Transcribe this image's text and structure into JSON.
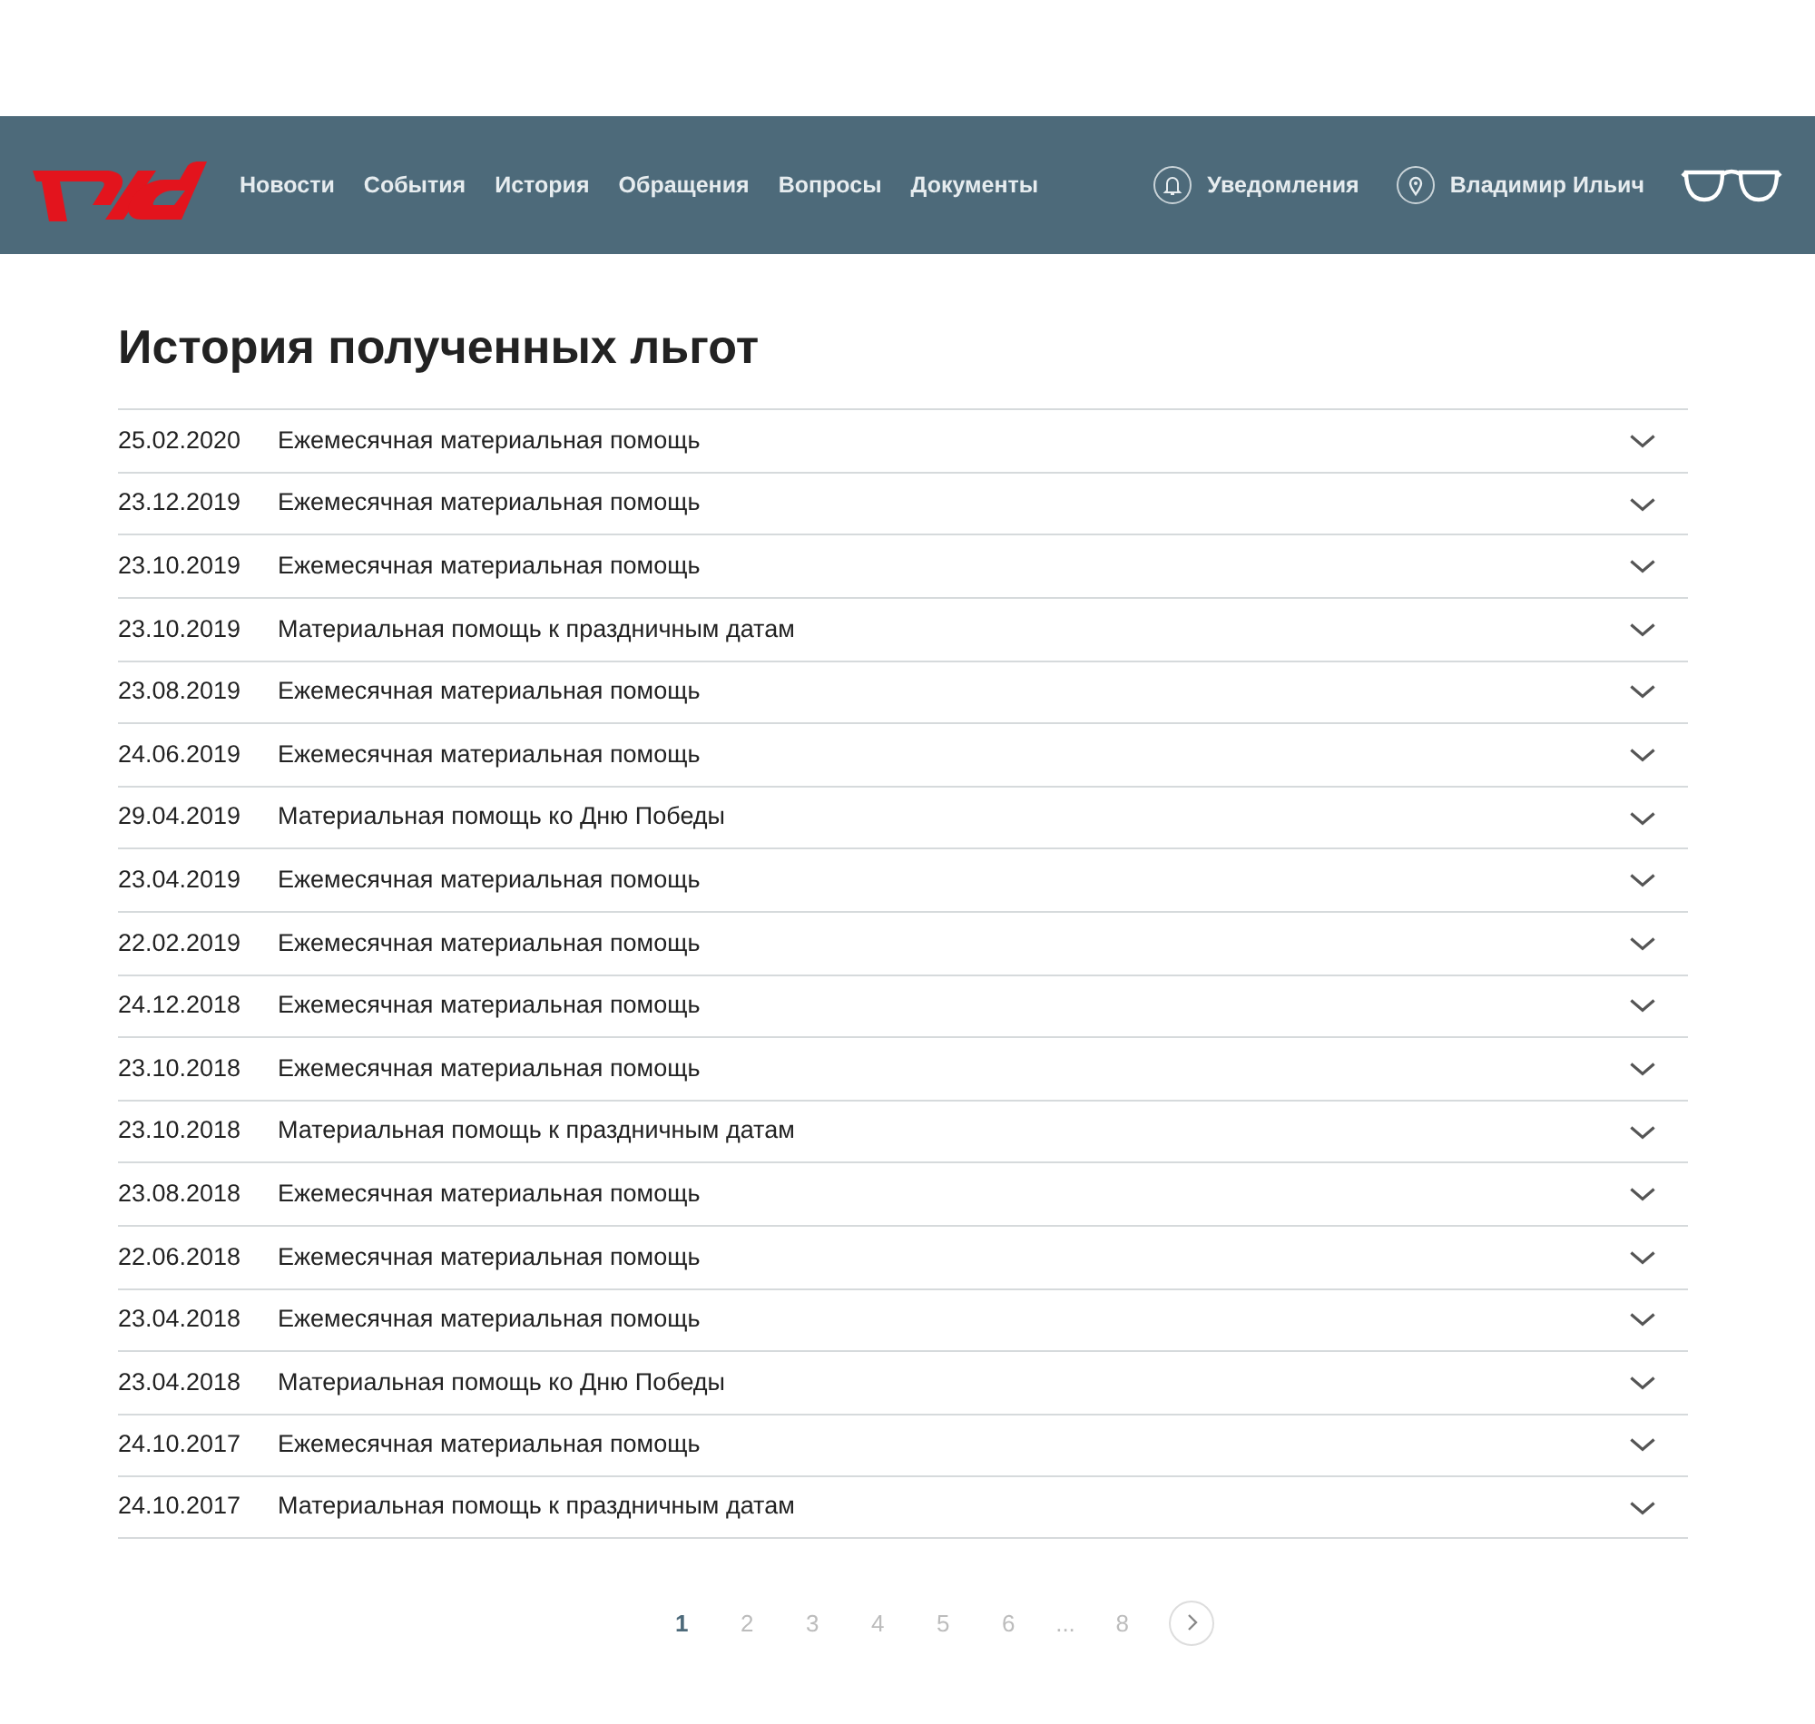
{
  "nav": {
    "links": [
      "Новости",
      "События",
      "История",
      "Обращения",
      "Вопросы",
      "Документы"
    ],
    "notifications": "Уведомления",
    "user": "Владимир Ильич"
  },
  "title": "История полученных льгот",
  "rows": [
    {
      "date": "25.02.2020",
      "name": "Ежемесячная материальная помощь",
      "expanded": false
    },
    {
      "date": "23.12.2019",
      "name": "Ежемесячная материальная помощь",
      "expanded": false
    },
    {
      "date": "23.10.2019",
      "name": "Ежемесячная материальная помощь",
      "expanded": false
    },
    {
      "date": "23.10.2019",
      "name": "Материальная помощь к праздничным датам",
      "expanded": false
    },
    {
      "date": "23.08.2019",
      "name": "Ежемесячная материальная помощь",
      "expanded": false
    },
    {
      "date": "24.06.2019",
      "name": "Ежемесячная материальная помощь",
      "expanded": false
    },
    {
      "date": "29.04.2019",
      "name": "Материальная помощь ко Дню Победы",
      "expanded": false
    },
    {
      "date": "23.04.2019",
      "name": "Ежемесячная материальная помощь",
      "expanded": false
    },
    {
      "date": "22.02.2019",
      "name": "Ежемесячная материальная помощь",
      "expanded": false
    },
    {
      "date": "24.12.2018",
      "name": "Ежемесячная материальная помощь",
      "expanded": false
    },
    {
      "date": "23.10.2018",
      "name": "Ежемесячная материальная помощь",
      "expanded": false
    },
    {
      "date": "23.10.2018",
      "name": "Материальная помощь к праздничным датам",
      "expanded": false
    },
    {
      "date": "23.08.2018",
      "name": "Ежемесячная материальная помощь",
      "expanded": false
    },
    {
      "date": "22.06.2018",
      "name": "Ежемесячная материальная помощь",
      "expanded": false
    },
    {
      "date": "23.04.2018",
      "name": "Ежемесячная материальная помощь",
      "expanded": false
    },
    {
      "date": "23.04.2018",
      "name": "Материальная помощь ко Дню Победы",
      "expanded": false
    },
    {
      "date": "24.10.2017",
      "name": "Ежемесячная материальная помощь",
      "expanded": false
    },
    {
      "date": "24.10.2017",
      "name": "Материальная помощь к праздничным датам",
      "expanded": false
    }
  ],
  "pagination": {
    "pages": [
      {
        "label": "1",
        "kind": "page",
        "selected": true
      },
      {
        "label": "2",
        "kind": "page",
        "selected": false
      },
      {
        "label": "3",
        "kind": "page",
        "selected": false
      },
      {
        "label": "4",
        "kind": "page",
        "selected": false
      },
      {
        "label": "5",
        "kind": "page",
        "selected": false
      },
      {
        "label": "6",
        "kind": "page",
        "selected": false
      },
      {
        "label": "...",
        "kind": "gap"
      },
      {
        "label": "8",
        "kind": "page",
        "selected": false
      }
    ]
  }
}
